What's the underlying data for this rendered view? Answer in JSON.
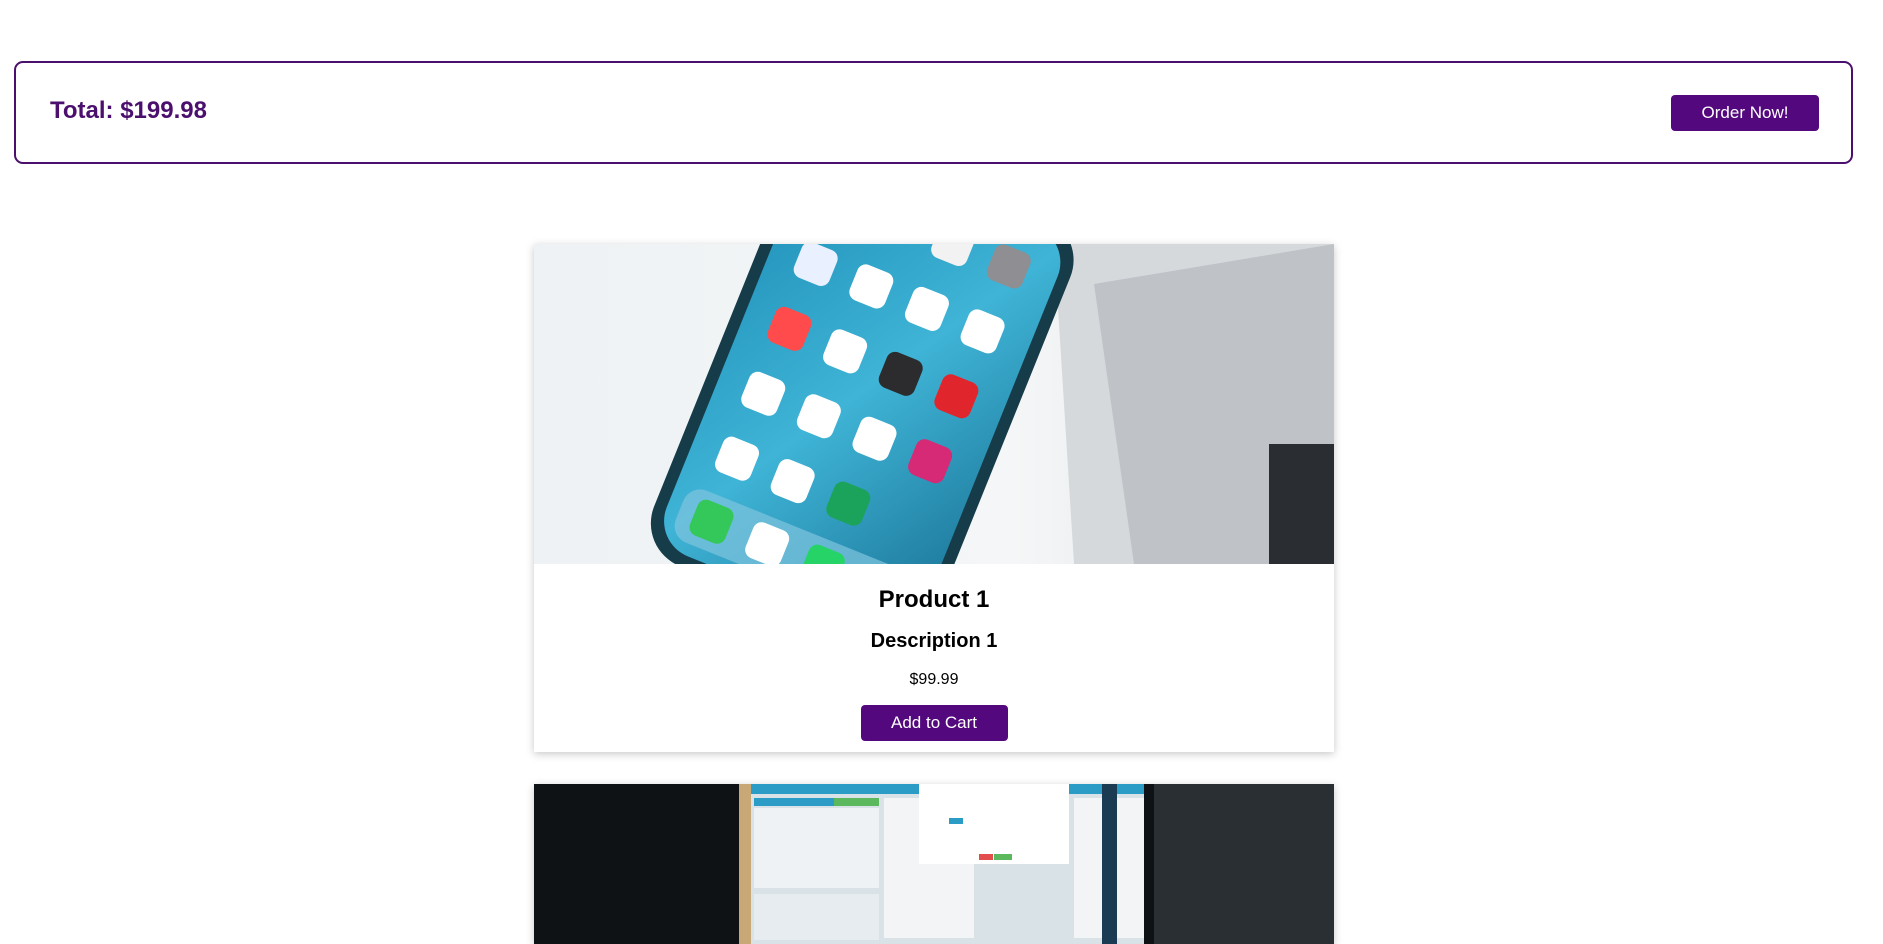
{
  "cart": {
    "total_label": "Total: $199.98",
    "order_button_label": "Order Now!"
  },
  "products": [
    {
      "title": "Product 1",
      "description": "Description 1",
      "price": "$99.99",
      "button_label": "Add to Cart",
      "image_icon": "smartphone-photo"
    },
    {
      "image_icon": "software-screenshot-photo"
    }
  ],
  "colors": {
    "accent": "#53097d",
    "border": "#4b0f6e"
  }
}
